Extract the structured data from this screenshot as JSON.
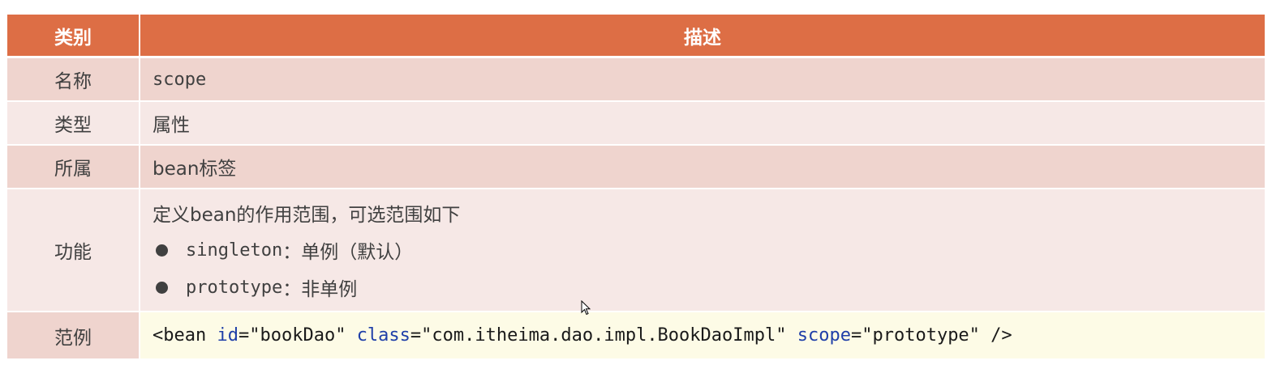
{
  "header": {
    "category": "类别",
    "description": "描述"
  },
  "rows": {
    "name": {
      "label": "名称",
      "value": "scope"
    },
    "type": {
      "label": "类型",
      "value": "属性"
    },
    "belongs": {
      "label": "所属",
      "value": "bean标签"
    },
    "function": {
      "label": "功能",
      "intro": "定义bean的作用范围，可选范围如下",
      "items": [
        {
          "term": "singleton",
          "sep": "：",
          "desc": "单例（默认）"
        },
        {
          "term": "prototype",
          "sep": "：",
          "desc": "非单例"
        }
      ]
    },
    "example": {
      "label": "范例",
      "code": {
        "open": "<bean ",
        "attr1": "id",
        "val1": "=\"bookDao\" ",
        "attr2": "class",
        "val2": "=\"com.itheima.dao.impl.BookDaoImpl\" ",
        "attr3": "scope",
        "val3": "=\"prototype\" ",
        "close": "/>"
      }
    }
  },
  "colors": {
    "header": "#dd6e45",
    "row_dark": "#efd4ce",
    "row_light": "#f6e8e6",
    "code_bg": "#fdfbe6",
    "attr_blue": "#1f3fa8"
  },
  "icons": {
    "bullet": "filled-circle",
    "cursor": "mouse-pointer"
  }
}
